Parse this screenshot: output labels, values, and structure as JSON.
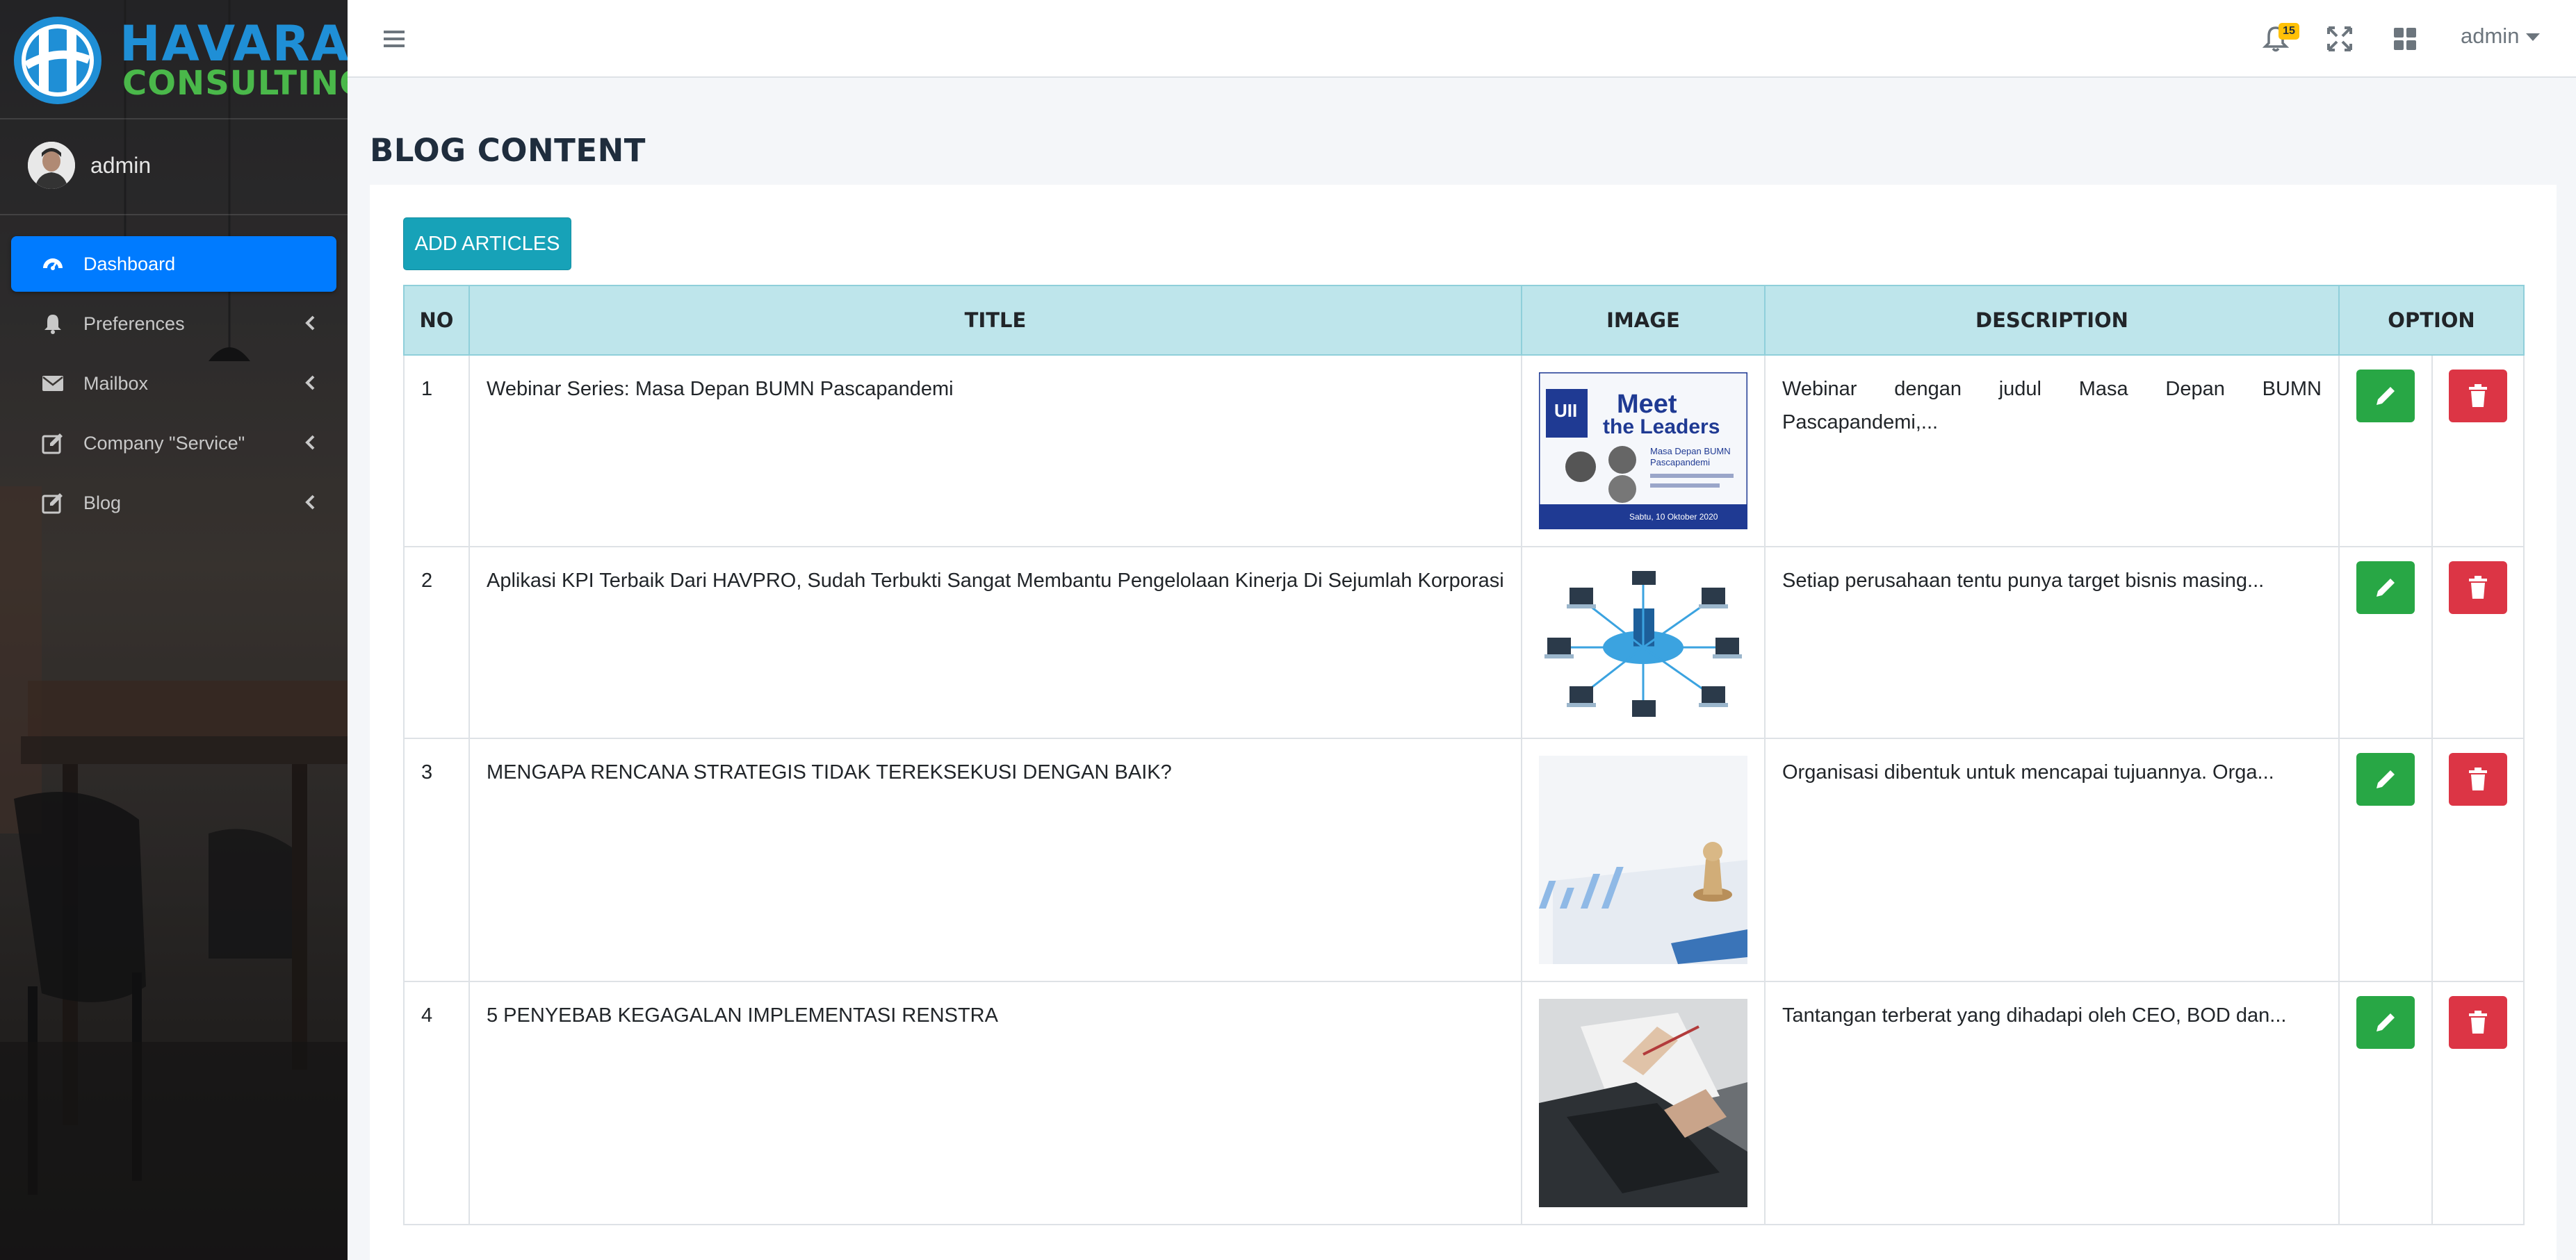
{
  "brand": {
    "line1": "HAVARA",
    "line2": "CONSULTING"
  },
  "user": {
    "name": "admin"
  },
  "sidebar": {
    "items": [
      {
        "label": "Dashboard",
        "icon": "tachometer-icon",
        "active": true
      },
      {
        "label": "Preferences",
        "icon": "bell-icon"
      },
      {
        "label": "Mailbox",
        "icon": "envelope-icon"
      },
      {
        "label": "Company \"Service\"",
        "icon": "edit-icon"
      },
      {
        "label": "Blog",
        "icon": "edit-icon"
      }
    ]
  },
  "topbar": {
    "notification_count": "15",
    "user_menu": "admin",
    "icons": [
      "menu-icon",
      "bell-icon",
      "expand-icon",
      "grid-icon"
    ]
  },
  "page": {
    "title": "BLOG CONTENT",
    "add_button": "ADD ARTICLES"
  },
  "table": {
    "headers": {
      "no": "NO",
      "title": "TITLE",
      "image": "IMAGE",
      "description": "DESCRIPTION",
      "option": "OPTION"
    },
    "rows": [
      {
        "no": "1",
        "title": "Webinar Series: Masa Depan BUMN Pascapandemi",
        "description": "Webinar dengan judul Masa Depan BUMN Pascapandemi,...",
        "poster": {
          "title_line1": "Meet",
          "title_line2": "the Leaders",
          "subtitle_line1": "Masa Depan BUMN",
          "subtitle_line2": "Pascapandemi",
          "date": "Sabtu, 10 Oktober 2020"
        }
      },
      {
        "no": "2",
        "title": "Aplikasi KPI Terbaik Dari HAVPRO, Sudah Terbukti Sangat Membantu Pengelolaan Kinerja Di Sejumlah Korporasi",
        "description": "Setiap perusahaan tentu punya target bisnis masing..."
      },
      {
        "no": "3",
        "title": "MENGAPA RENCANA STRATEGIS TIDAK TEREKSEKUSI DENGAN BAIK?",
        "description": "Organisasi dibentuk untuk mencapai tujuannya. Orga..."
      },
      {
        "no": "4",
        "title": "5 PENYEBAB KEGAGALAN IMPLEMENTASI RENSTRA",
        "description": "Tantangan terberat yang dihadapi oleh CEO, BOD dan..."
      }
    ]
  },
  "colors": {
    "primary": "#007bff",
    "info": "#17a2b8",
    "success": "#28a745",
    "danger": "#dc3545",
    "warning": "#ffc107",
    "table_head": "#bee5eb"
  }
}
